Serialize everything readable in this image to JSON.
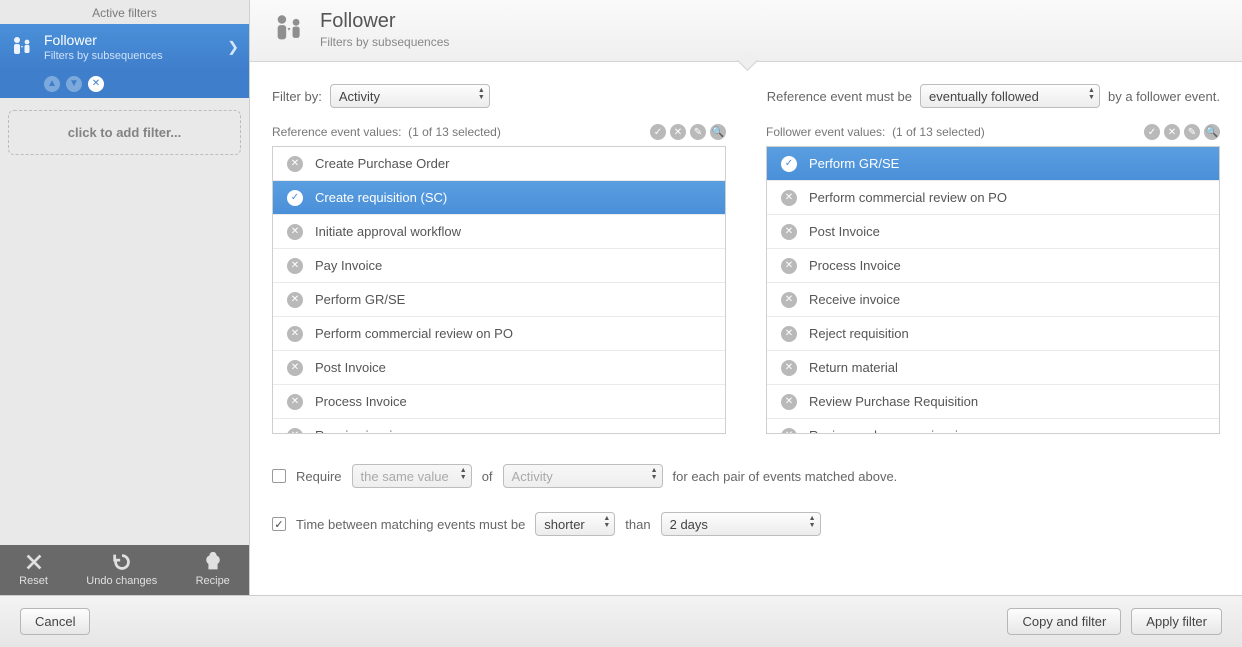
{
  "sidebar": {
    "title": "Active filters",
    "active_filter": {
      "title": "Follower",
      "subtitle": "Filters by subsequences"
    },
    "add_filter_label": "click to add filter...",
    "footer": {
      "reset": "Reset",
      "undo": "Undo changes",
      "recipe": "Recipe"
    }
  },
  "header": {
    "title": "Follower",
    "subtitle": "Filters by subsequences"
  },
  "controls": {
    "filter_by_label": "Filter by:",
    "filter_by_value": "Activity",
    "ref_must_be_label": "Reference event must be",
    "ref_mode_value": "eventually followed",
    "by_follower_label": "by a follower event."
  },
  "reference": {
    "label": "Reference event values:",
    "count": "(1 of 13 selected)",
    "items": [
      {
        "label": "Create Purchase Order",
        "selected": false
      },
      {
        "label": "Create requisition (SC)",
        "selected": true
      },
      {
        "label": "Initiate approval workflow",
        "selected": false
      },
      {
        "label": "Pay Invoice",
        "selected": false
      },
      {
        "label": "Perform GR/SE",
        "selected": false
      },
      {
        "label": "Perform commercial review on PO",
        "selected": false
      },
      {
        "label": "Post Invoice",
        "selected": false
      },
      {
        "label": "Process Invoice",
        "selected": false
      },
      {
        "label": "Receive invoice",
        "selected": false
      }
    ]
  },
  "follower": {
    "label": "Follower event values:",
    "count": "(1 of 13 selected)",
    "items": [
      {
        "label": "Perform GR/SE",
        "selected": true
      },
      {
        "label": "Perform commercial review on PO",
        "selected": false
      },
      {
        "label": "Post Invoice",
        "selected": false
      },
      {
        "label": "Process Invoice",
        "selected": false
      },
      {
        "label": "Receive invoice",
        "selected": false
      },
      {
        "label": "Reject requisition",
        "selected": false
      },
      {
        "label": "Return material",
        "selected": false
      },
      {
        "label": "Review Purchase Requisition",
        "selected": false
      },
      {
        "label": "Review and approve invoice",
        "selected": false
      }
    ]
  },
  "options": {
    "require": {
      "checked": false,
      "label": "Require",
      "value_select": "the same value",
      "of_label": "of",
      "attr_select": "Activity",
      "tail_label": "for each pair of events matched above."
    },
    "time": {
      "checked": true,
      "label": "Time between matching events must be",
      "comparator": "shorter",
      "than_label": "than",
      "duration": "2 days"
    }
  },
  "footer": {
    "cancel": "Cancel",
    "copy_and_filter": "Copy and filter",
    "apply_filter": "Apply filter"
  }
}
